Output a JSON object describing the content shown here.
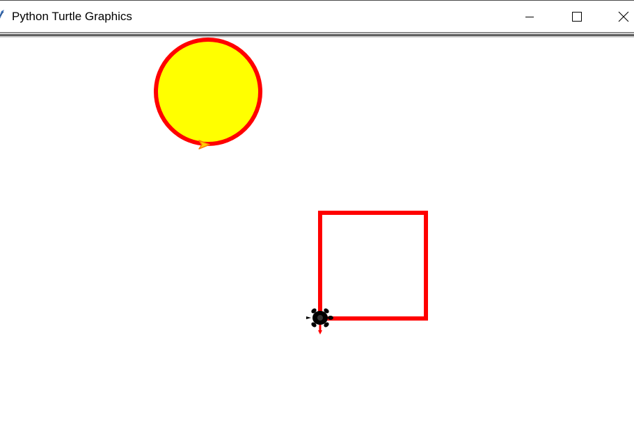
{
  "window": {
    "title": "Python Turtle Graphics",
    "controls": {
      "minimize": "minimize-icon",
      "maximize": "maximize-icon",
      "close": "close-icon"
    }
  },
  "canvas": {
    "background": "#ffffff",
    "circle": {
      "fill_color": "#ffff00",
      "pen_color": "#ff0000"
    },
    "square": {
      "pen_color": "#ff0000"
    },
    "turtle": {
      "shape": "turtle",
      "color": "#000000"
    },
    "arrow_cursor": {
      "shape": "arrow",
      "color": "#ff8c00"
    }
  }
}
